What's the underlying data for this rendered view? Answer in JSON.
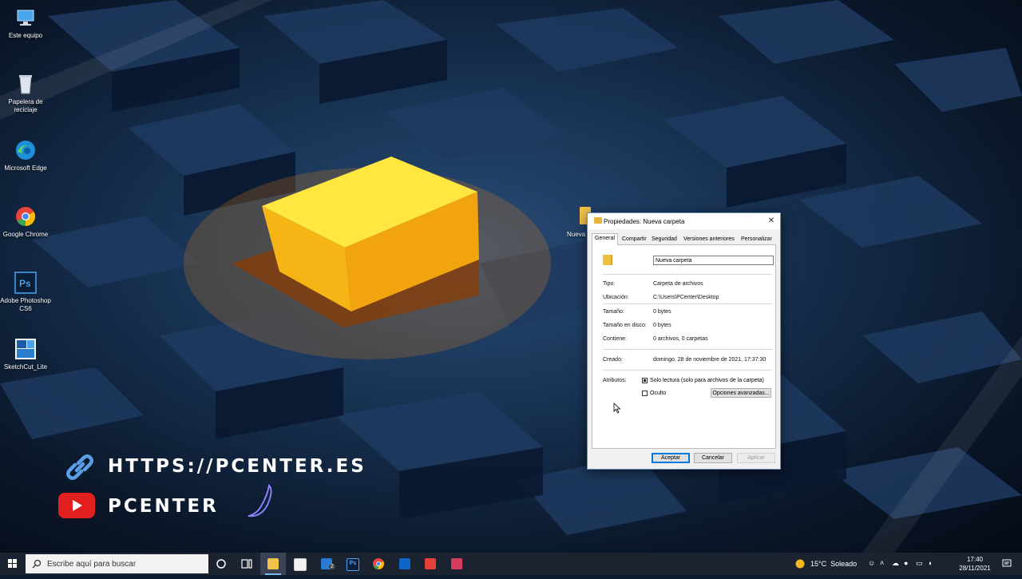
{
  "desktop": {
    "icons": [
      {
        "label": "Este equipo"
      },
      {
        "label": "Papelera de reciclaje"
      },
      {
        "label": "Microsoft Edge"
      },
      {
        "label": "Google Chrome"
      },
      {
        "label": "Adobe Photoshop CS6"
      },
      {
        "label": "SketchCut_Lite"
      }
    ],
    "folder_label": "Nueva"
  },
  "watermark": {
    "url": "HTTPS://PCENTER.ES",
    "brand": "PCENTER"
  },
  "dialog": {
    "title": "Propiedades: Nueva carpeta",
    "tabs": [
      "General",
      "Compartir",
      "Seguridad",
      "Versiones anteriores",
      "Personalizar"
    ],
    "active_tab": "General",
    "name_value": "Nueva carpeta",
    "props": [
      {
        "label": "Tipo:",
        "value": "Carpeta de archivos"
      },
      {
        "label": "Ubicación:",
        "value": "C:\\Users\\PCenter\\Desktop"
      },
      {
        "label": "Tamaño:",
        "value": "0 bytes"
      },
      {
        "label": "Tamaño en disco:",
        "value": "0 bytes"
      },
      {
        "label": "Contiene:",
        "value": "0 archivos, 0 carpetas"
      }
    ],
    "created_label": "Creado:",
    "created_value": "domingo, 28 de noviembre de 2021, 17:37:30",
    "attributes_label": "Atributos:",
    "readonly_label": "Solo lectura (solo para archivos de la carpeta)",
    "readonly_checked": true,
    "hidden_label": "Oculto",
    "hidden_checked": false,
    "advanced_button": "Opciones avanzadas...",
    "ok_button": "Aceptar",
    "cancel_button": "Cancelar",
    "apply_button": "Aplicar"
  },
  "taskbar": {
    "search_placeholder": "Escribe aquí para buscar",
    "mail_badge": "2",
    "ps_label": "Ps",
    "weather": "15°C  Soleado",
    "time": "17:40",
    "date": "28/11/2021"
  }
}
